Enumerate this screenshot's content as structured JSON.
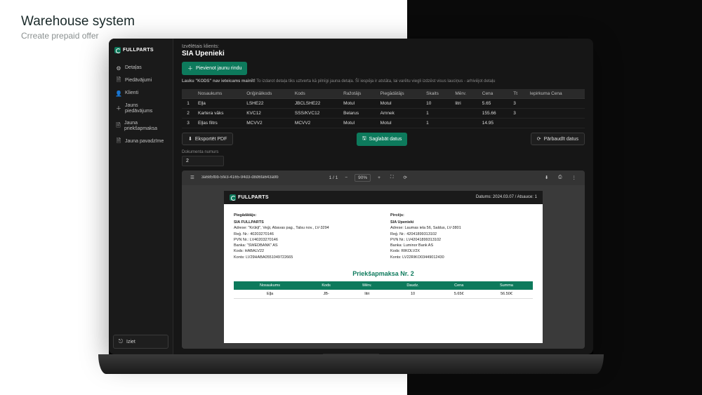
{
  "page": {
    "title": "Warehouse system",
    "subtitle": "Crreate prepaid offer"
  },
  "brand": "FULLPARTS",
  "sidebar": {
    "items": [
      {
        "label": "Detaļas",
        "icon": "⚙"
      },
      {
        "label": "Piedāvājumi",
        "icon": "🗎"
      },
      {
        "label": "Klienti",
        "icon": "👤"
      },
      {
        "label": "Jauns piedāvājums",
        "icon": "＋"
      },
      {
        "label": "Jauna priekšapmaksa",
        "icon": "🗎"
      },
      {
        "label": "Jauna pavadzīme",
        "icon": "🗎"
      }
    ],
    "logout": "Iziet"
  },
  "header": {
    "kicker": "Izvēlētais klients:",
    "client": "SIA Upenieki",
    "add_row": "Pievienot jaunu rindu",
    "hint_b": "Lauku \"KODS\" nav ieteicams mainīt!",
    "hint": "To izdarot detaļa tiks uztverta kā pilnīgi jauna detaļa. Šī iespēja ir atstāta, lai varētu viegli izdzēst visus lauciņus - arhivējot detaļu"
  },
  "table": {
    "cols": [
      "",
      "Nosaukums",
      "Oriģinālkods",
      "Kods",
      "Ražotājs",
      "Piegādātājs",
      "Skaits",
      "Mērv.",
      "Cena",
      "Tt",
      "Iepirkuma Cena"
    ],
    "rows": [
      [
        "1",
        "Eļļa",
        "LSHE22",
        "JBCLSHE22",
        "Motul",
        "Motul",
        "10",
        "litri",
        "5.65",
        "3",
        ""
      ],
      [
        "2",
        "Kartera vāks",
        "KVC12",
        "SSS/KVC12",
        "Belarus",
        "Amnek",
        "1",
        "",
        "155.66",
        "3",
        ""
      ],
      [
        "3",
        "Eļļas filtrs",
        "MCVV2",
        "MCVV2",
        "Motul",
        "Motul",
        "1",
        "",
        "14.95",
        "",
        ""
      ]
    ]
  },
  "actions": {
    "export": "Eksportēt PDF",
    "save": "Saglabāt datus",
    "check": "Pārbaudīt datus"
  },
  "doc": {
    "label": "Dokumenta numurs",
    "value": "2"
  },
  "pdf": {
    "filename": "3a685fbb-5fe3-4165-94d3-d8d6fa643a9b",
    "page": "1",
    "pages": "1",
    "zoom": "90%",
    "date_label": "Datums:",
    "date": "2024.03.07",
    "ref_label": "Atsauce:",
    "ref": "1",
    "supplier": {
      "h": "Piegādātājs:",
      "name": "SIA FULLPARTS",
      "lines": [
        "Adrese: \"Krūkļi\", Veģi, Abavas pag., Talsu nov., LV-3294",
        "Reģ. Nr.: 40203270146",
        "PVN Nr.: LV40203270146",
        "Banka: \"SWEDBANK\" AS",
        "Kods: HABALV22",
        "Konts: LV29HABA0551049722665"
      ]
    },
    "buyer": {
      "h": "Pircējs:",
      "name": "SIA Upenieki",
      "lines": [
        "Adrese: Laumas iela 56, Saldus, LV-3801",
        "Reģ. Nr.: 42041899313102",
        "PVN Nr.: LV42041899313102",
        "Banka: Luminor Bank AS",
        "Kods: RIKOLV2X",
        "Konts: LV22RIKO03449012430"
      ]
    },
    "inv_title": "Priekšapmaksa Nr. 2",
    "inv_cols": [
      "Nosaukums",
      "Kods",
      "Mērv.",
      "Daudz.",
      "Cena",
      "Summa"
    ],
    "inv_rows": [
      [
        "Eļļa",
        "JB-",
        "litri",
        "10",
        "5.65€",
        "56.50€"
      ]
    ]
  }
}
